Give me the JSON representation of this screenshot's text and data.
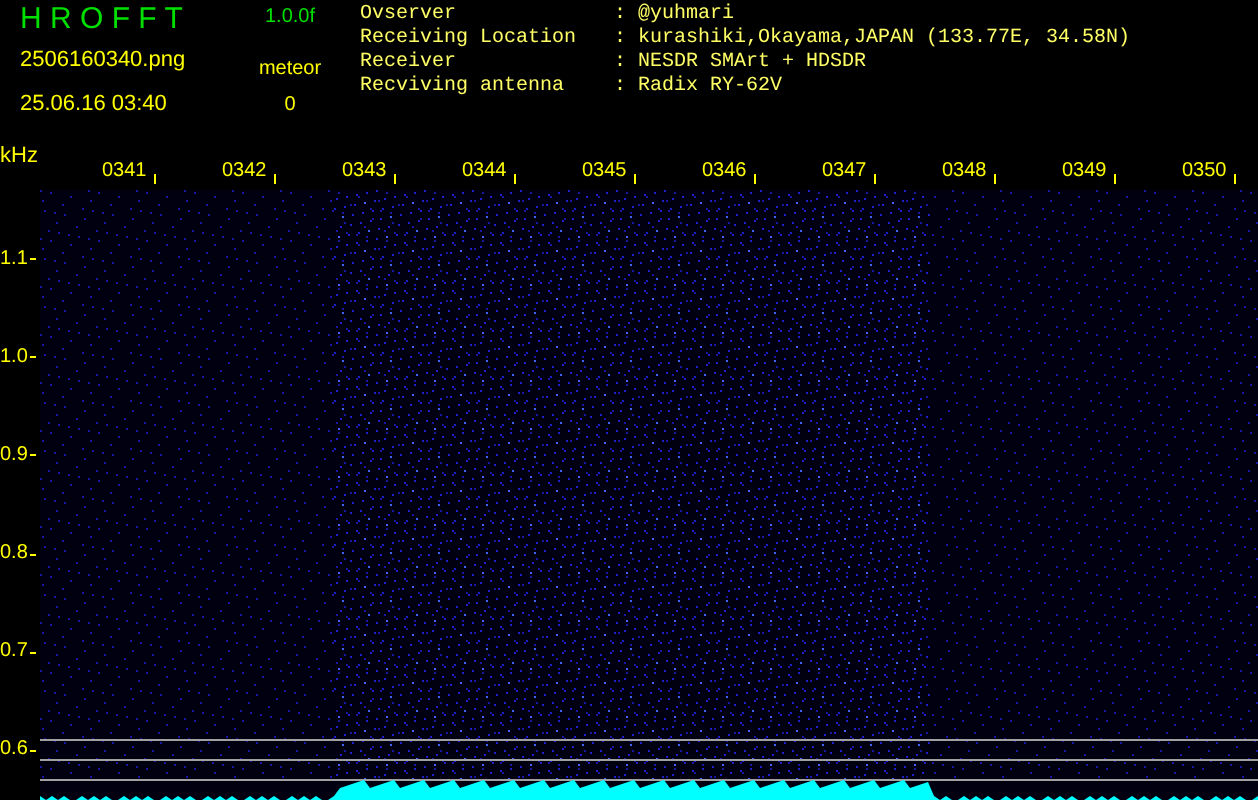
{
  "app": {
    "title": "H R O F F T",
    "version": "1.0.0f",
    "filename": "2506160340.png",
    "datetime": "25.06.16 03:40",
    "counter_label": "meteor",
    "counter_value": "0"
  },
  "info": [
    {
      "label": "Ovserver",
      "separator": ":",
      "value": "@yuhmari"
    },
    {
      "label": "Receiving Location",
      "separator": ":",
      "value": "kurashiki,Okayama,JAPAN (133.77E, 34.58N)"
    },
    {
      "label": "Receiver",
      "separator": ":",
      "value": "NESDR SMArt + HDSDR"
    },
    {
      "label": "Recviving antenna",
      "separator": ":",
      "value": "Radix RY-62V"
    }
  ],
  "plot": {
    "unit": "kHz",
    "time_labels": [
      "0341",
      "0342",
      "0343",
      "0344",
      "0345",
      "0346",
      "0347",
      "0348",
      "0349",
      "0350"
    ],
    "freq_labels": [
      "1.1",
      "1.0",
      "0.9",
      "0.8",
      "0.7",
      "0.6"
    ]
  }
}
